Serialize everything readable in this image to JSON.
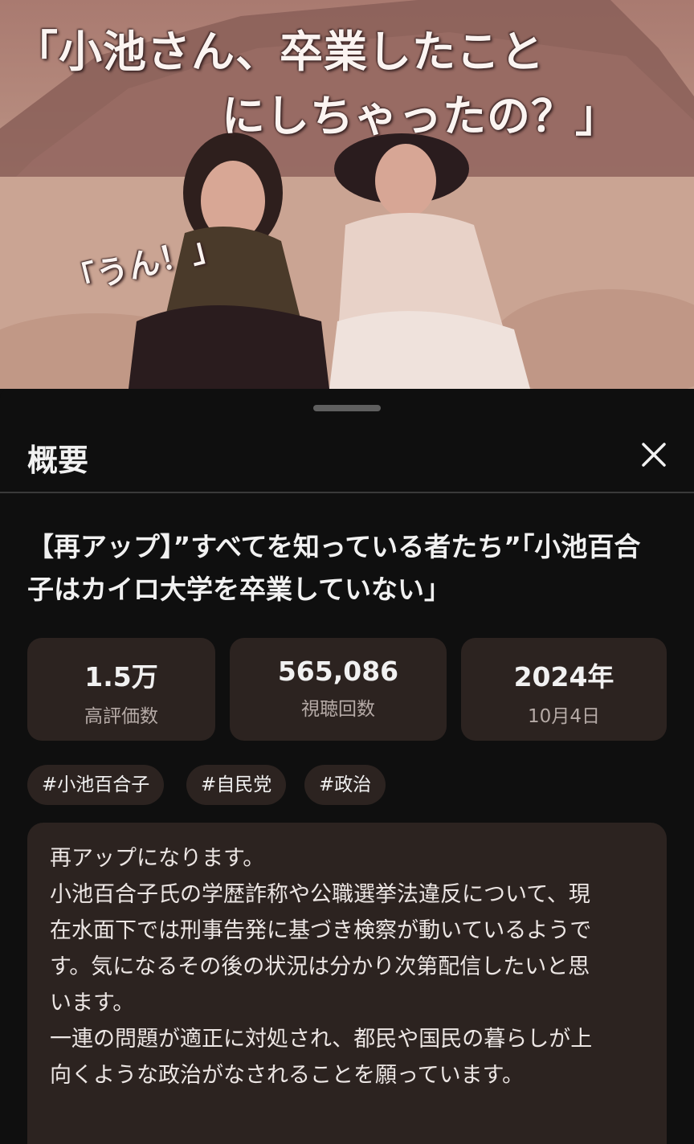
{
  "thumbnail": {
    "caption_line1": "「小池さん、卒業したこと",
    "caption_line2": "にしちゃったの？」",
    "caption_reply": "「うん！」"
  },
  "sheet": {
    "title": "概要",
    "close_label": "✕"
  },
  "video": {
    "title": "【再アップ】”すべてを知っている者たち”「小池百合子はカイロ大学を卒業していない」"
  },
  "stats": [
    {
      "value": "1.5万",
      "label": "高評価数"
    },
    {
      "value": "565,086",
      "label": "視聴回数"
    },
    {
      "value": "2024年",
      "label": "10月4日"
    }
  ],
  "hashtags": [
    "#小池百合子",
    "#自民党",
    "#政治"
  ],
  "description": {
    "lines": [
      "再アップになります。",
      "小池百合子氏の学歴詐称や公職選挙法違反について、現",
      "在水面下では刑事告発に基づき検察が動いているようで",
      "す。気になるその後の状況は分かり次第配信したいと思",
      "います。",
      "一連の問題が適正に対処され、都民や国民の暮らしが上",
      "向くような政治がなされることを願っています。"
    ]
  },
  "colors": {
    "sheet_background": "#0f0f0f",
    "card_background": "#2c2320",
    "text_primary": "#f1f1f1",
    "text_secondary": "#b5aaa6"
  }
}
